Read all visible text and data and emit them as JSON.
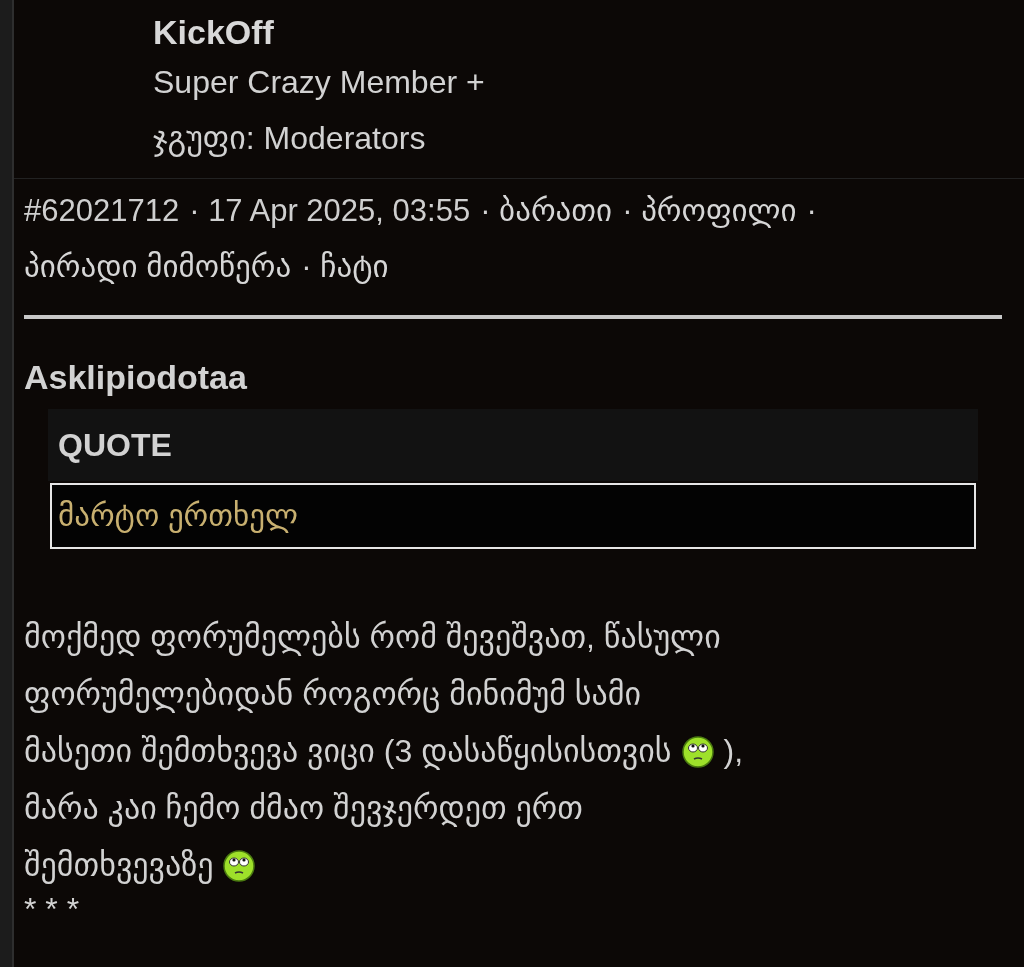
{
  "author": {
    "name": "KickOff",
    "rank": "Super Crazy Member +",
    "group": "ჯგუფი: Moderators"
  },
  "meta": {
    "separator": "·",
    "items": [
      {
        "kind": "text",
        "text": "#62021712"
      },
      {
        "kind": "text",
        "text": "17 Apr 2025, 03:55"
      },
      {
        "kind": "link",
        "text": "ბარათი"
      },
      {
        "kind": "link",
        "text": "პროფილი"
      },
      {
        "kind": "link",
        "text": "პირადი მიმოწერა"
      },
      {
        "kind": "link",
        "text": "ჩატი"
      }
    ]
  },
  "post": {
    "quoted_author": "Asklipiodotaa",
    "quote": {
      "header": "QUOTE",
      "text": "მარტო ერთხელ"
    },
    "body": [
      [
        {
          "kind": "text",
          "text": "მოქმედ ფორუმელებს რომ შევეშვათ, წასული"
        }
      ],
      [
        {
          "kind": "text",
          "text": "ფორუმელებიდან როგორც მინიმუმ სამი"
        }
      ],
      [
        {
          "kind": "text",
          "text": "მასეთი შემთხვევა ვიცი (3 დასაწყისისთვის"
        },
        {
          "kind": "smiley"
        },
        {
          "kind": "text",
          "text": "),"
        }
      ],
      [
        {
          "kind": "text",
          "text": "მარა კაი ჩემო ძმაო შევჯერდეთ ერთ"
        }
      ],
      [
        {
          "kind": "text",
          "text": "შემთხვევაზე"
        },
        {
          "kind": "smiley"
        }
      ]
    ],
    "footer": "* * *"
  }
}
